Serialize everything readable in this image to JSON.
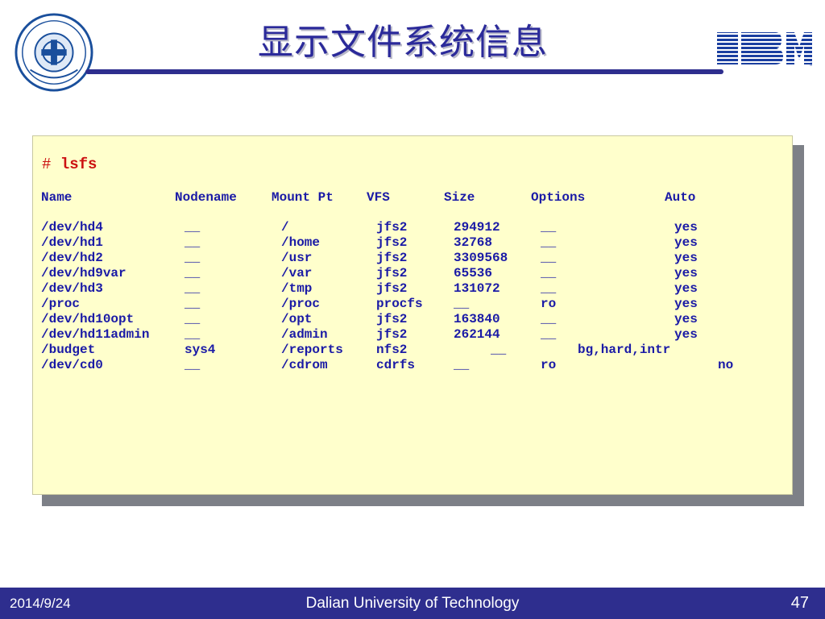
{
  "slide": {
    "title": "显示文件系统信息",
    "logo_text": "IBM"
  },
  "terminal": {
    "prompt": "#",
    "command": "lsfs",
    "headers": [
      "Name",
      "Nodename",
      "Mount Pt",
      "VFS",
      "Size",
      "Options",
      "Auto"
    ],
    "rows": [
      {
        "name": "/dev/hd4",
        "nodename": "__",
        "mount": "/",
        "vfs": "jfs2",
        "size": "294912",
        "options": "__",
        "auto": "yes"
      },
      {
        "name": "/dev/hd1",
        "nodename": "__",
        "mount": "/home",
        "vfs": "jfs2",
        "size": "32768",
        "options": "__",
        "auto": "yes"
      },
      {
        "name": "/dev/hd2",
        "nodename": "__",
        "mount": "/usr",
        "vfs": "jfs2",
        "size": "3309568",
        "options": "__",
        "auto": "yes"
      },
      {
        "name": "/dev/hd9var",
        "nodename": "__",
        "mount": "/var",
        "vfs": "jfs2",
        "size": "65536",
        "options": "__",
        "auto": "yes"
      },
      {
        "name": "/dev/hd3",
        "nodename": "__",
        "mount": "/tmp",
        "vfs": "jfs2",
        "size": "131072",
        "options": "__",
        "auto": "yes"
      },
      {
        "name": "/proc",
        "nodename": "__",
        "mount": "/proc",
        "vfs": "procfs",
        "size": "__",
        "options": "ro",
        "auto": "yes"
      },
      {
        "name": "/dev/hd10opt",
        "nodename": "__",
        "mount": "/opt",
        "vfs": "jfs2",
        "size": "163840",
        "options": "__",
        "auto": "yes"
      },
      {
        "name": "/dev/hd11admin",
        "nodename": "__",
        "mount": "/admin",
        "vfs": "jfs2",
        "size": "262144",
        "options": "__",
        "auto": "yes"
      },
      {
        "name": "/budget",
        "nodename": "sys4",
        "mount": "/reports",
        "vfs": "nfs2",
        "size": "__",
        "options": "bg,hard,intr",
        "auto": ""
      },
      {
        "name": "/dev/cd0",
        "nodename": "__",
        "mount": "/cdrom",
        "vfs": "cdrfs",
        "size": "__",
        "options": "ro",
        "auto": "no"
      }
    ]
  },
  "footer": {
    "date": "2014/9/24",
    "center": "Dalian University of Technology",
    "page": "47"
  },
  "colors": {
    "title": "#2b2a9a",
    "bar": "#2e2e8e",
    "terminal_bg": "#ffffcc",
    "terminal_text": "#1a1aa6",
    "command": "#cc1111"
  }
}
